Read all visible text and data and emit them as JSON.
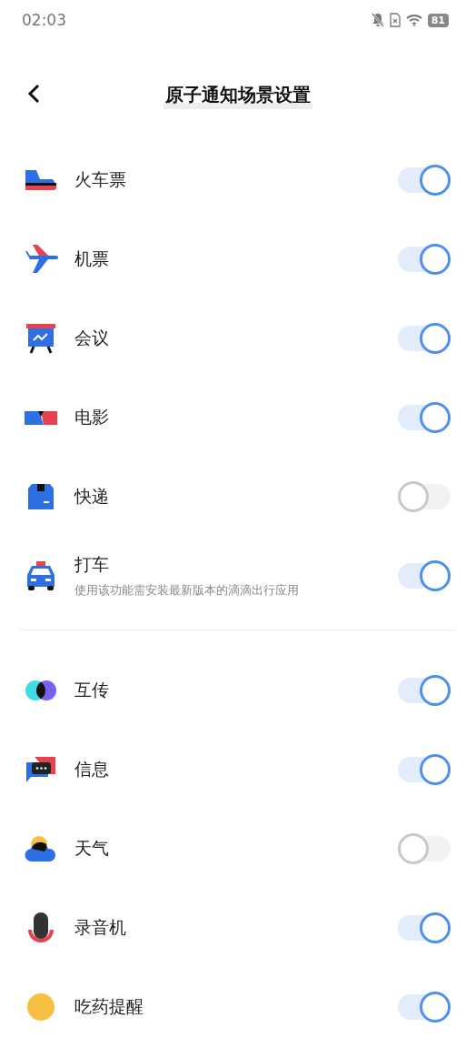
{
  "status_bar": {
    "time": "02:03",
    "battery": "81"
  },
  "header": {
    "title": "原子通知场景设置"
  },
  "sections": [
    {
      "items": [
        {
          "label": "火车票",
          "on": true
        },
        {
          "label": "机票",
          "on": true
        },
        {
          "label": "会议",
          "on": true
        },
        {
          "label": "电影",
          "on": true
        },
        {
          "label": "快递",
          "on": false
        },
        {
          "label": "打车",
          "subtitle": "使用该功能需安装最新版本的滴滴出行应用",
          "on": true
        }
      ]
    },
    {
      "items": [
        {
          "label": "互传",
          "on": true
        },
        {
          "label": "信息",
          "on": true
        },
        {
          "label": "天气",
          "on": false
        },
        {
          "label": "录音机",
          "on": true
        },
        {
          "label": "吃药提醒",
          "on": true
        }
      ]
    }
  ]
}
